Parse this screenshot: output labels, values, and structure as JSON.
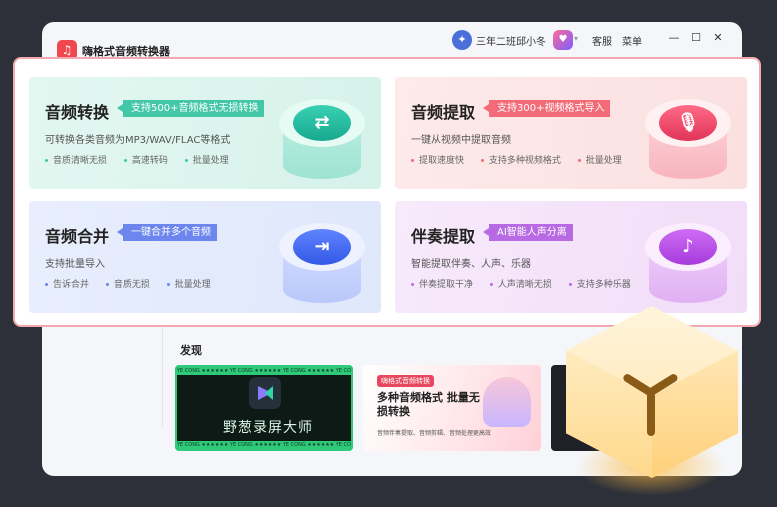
{
  "app": {
    "title": "嗨格式音频转换器",
    "logo_glyph": "♫"
  },
  "header": {
    "user_name": "三年二班邱小冬",
    "user_avatar_glyph": "✦",
    "vip_glyph": "♥",
    "vip_caret": "▾",
    "service_label": "客服",
    "menu_label": "菜单",
    "minimize_glyph": "—",
    "maximize_glyph": "☐",
    "close_glyph": "✕"
  },
  "features": [
    {
      "title": "音频转换",
      "badge": "支持500+音频格式无损转换",
      "desc": "可转换各类音频为MP3/WAV/FLAC等格式",
      "points": [
        "音质清晰无损",
        "高速转码",
        "批量处理"
      ],
      "icon_glyph": "⇄",
      "color": "#43c7a7"
    },
    {
      "title": "音频提取",
      "badge": "支持300+视频格式导入",
      "desc": "一键从视频中提取音频",
      "points": [
        "提取速度快",
        "支持多种视频格式",
        "批量处理"
      ],
      "icon_glyph": "🎙",
      "color": "#f46b78"
    },
    {
      "title": "音频合并",
      "badge": "一键合并多个音频",
      "desc": "支持批量导入",
      "points": [
        "告诉合并",
        "音质无损",
        "批量处理"
      ],
      "icon_glyph": "⇥",
      "color": "#6c86ee"
    },
    {
      "title": "伴奏提取",
      "badge": "AI智能人声分离",
      "desc": "智能提取伴奏、人声、乐器",
      "points": [
        "伴奏提取干净",
        "人声清晰无损",
        "支持多种乐器"
      ],
      "icon_glyph": "♪",
      "color": "#b86ae4"
    }
  ],
  "discover": {
    "title": "发现",
    "banner1": {
      "strip_text": "YE CONG ★★★★★★ YE CONG ★★★★★★ YE CONG ★★★★★★ YE CONG ★★★★★★",
      "caption": "野葱录屏大师"
    },
    "banner2": {
      "tag": "嗨格式音频转换",
      "headline": "多种音频格式 批量无损转换",
      "sub": "音频伴奏提取、音频剪辑、音频处理更高效"
    }
  }
}
